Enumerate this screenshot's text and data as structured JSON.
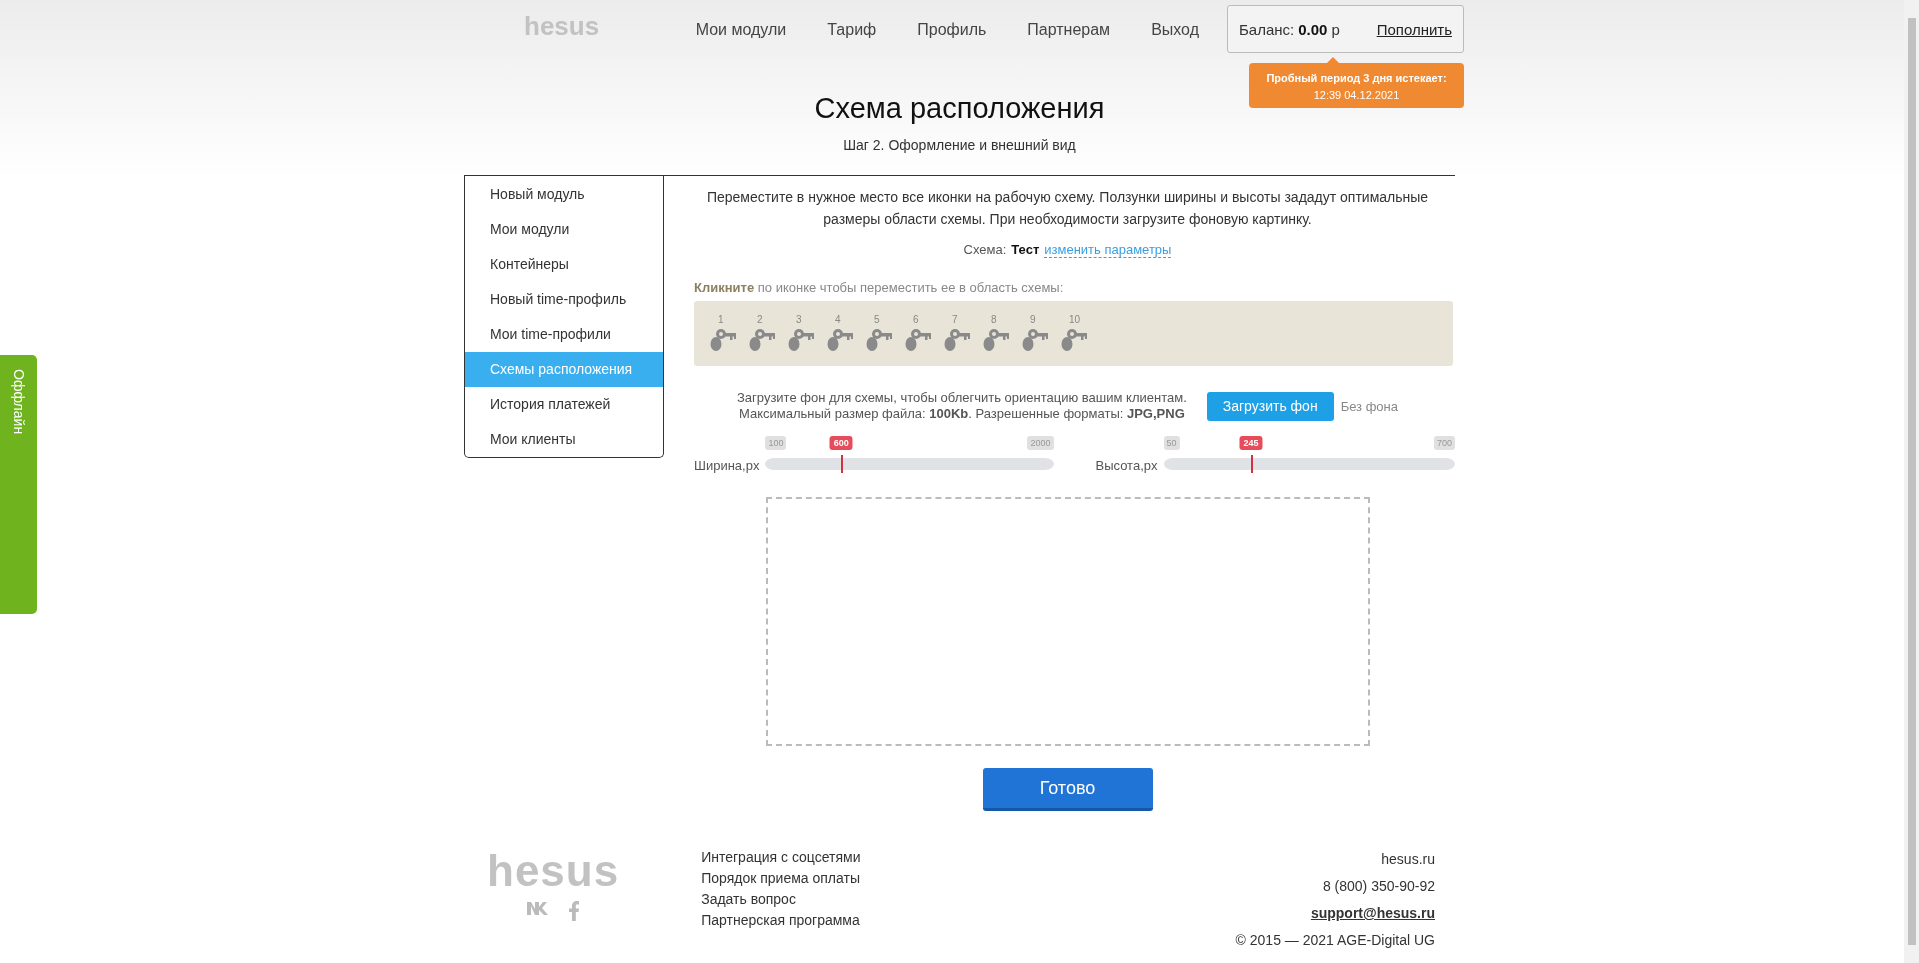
{
  "offline_tab": {
    "label": "Оффлайн"
  },
  "header": {
    "logo": "hesus",
    "nav": [
      {
        "label": "Мои модули"
      },
      {
        "label": "Тариф"
      },
      {
        "label": "Профиль"
      },
      {
        "label": "Партнерам"
      },
      {
        "label": "Выход"
      }
    ],
    "balance": {
      "label": "Баланс:",
      "amount": "0.00",
      "currency": "р",
      "action": "Пополнить"
    },
    "trial": {
      "title": "Пробный период 3 дня истекает:",
      "date": "12:39 04.12.2021"
    }
  },
  "page": {
    "title": "Схема расположения",
    "subtitle": "Шаг 2. Оформление и внешний вид"
  },
  "sidebar": {
    "items": [
      {
        "label": "Новый модуль",
        "selected": false
      },
      {
        "label": "Мои модули",
        "selected": false
      },
      {
        "label": "Контейнеры",
        "selected": false
      },
      {
        "label": "Новый time-профиль",
        "selected": false
      },
      {
        "label": "Мои time-профили",
        "selected": false
      },
      {
        "label": "Схемы расположения",
        "selected": true
      },
      {
        "label": "История платежей",
        "selected": false
      },
      {
        "label": "Мои клиенты",
        "selected": false
      }
    ]
  },
  "intro": "Переместите в нужное место все иконки на рабочую схему. Ползунки ширины и высоты зададут оптимальные размеры области схемы. При необходимости загрузите фоновую картинку.",
  "scheme": {
    "label": "Схема:",
    "name": "Тест",
    "link": "изменить параметры"
  },
  "icons_hint": "**Кликните** по иконке чтобы переместить ее в область схемы:",
  "icons": [
    {
      "number": "1"
    },
    {
      "number": "2"
    },
    {
      "number": "3"
    },
    {
      "number": "4"
    },
    {
      "number": "5"
    },
    {
      "number": "6"
    },
    {
      "number": "7"
    },
    {
      "number": "8"
    },
    {
      "number": "9"
    },
    {
      "number": "10"
    }
  ],
  "upload": {
    "line1": "Загрузите фон для схемы, чтобы облегчить ориентацию вашим клиентам.",
    "line2": "Максимальный размер файла: **100Kb**. Разрешенные форматы: **JPG,PNG**",
    "button": "Загрузить фон",
    "no_background": "Без фона"
  },
  "sliders": [
    {
      "label": "Ширина,px",
      "min": "100",
      "max": "2000",
      "value": "600",
      "level": 0.263
    },
    {
      "label": "Высота,px",
      "min": "50",
      "max": "700",
      "value": "245",
      "level": 0.3
    }
  ],
  "done_button": "Готово",
  "footer": {
    "logo": "hesus",
    "links": [
      {
        "label": "Интеграция с соцсетями"
      },
      {
        "label": "Порядок приема оплаты"
      },
      {
        "label": "Задать вопрос"
      },
      {
        "label": "Партнерская программа"
      }
    ],
    "site": "hesus.ru",
    "phone": "8 (800) 350-90-92",
    "email": "support@hesus.ru",
    "copyright": "© 2015 — 2021 AGE-Digital UG"
  }
}
